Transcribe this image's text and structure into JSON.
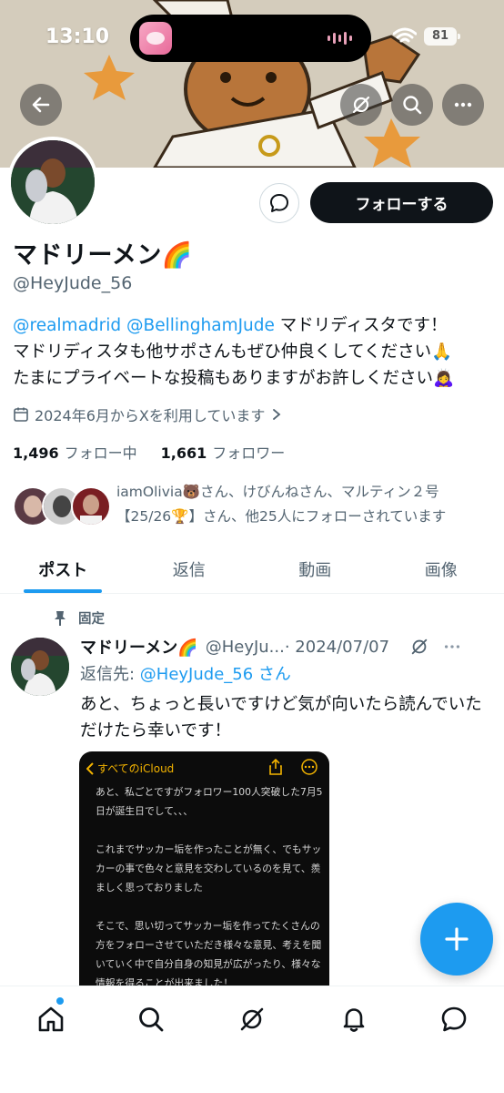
{
  "status_bar": {
    "time": "13:10",
    "battery": "81"
  },
  "header": {
    "back_icon": "arrow-left-icon",
    "grok_icon": "slash-circle-icon",
    "search_icon": "search-icon",
    "more_icon": "more-horizontal-icon"
  },
  "profile": {
    "name": "マドリーメン🌈",
    "handle": "@HeyJude_56",
    "follow_label": "フォローする",
    "bio_mention_1": "@realmadrid",
    "bio_mention_2": "@BellinghamJude",
    "bio_rest_1": " マドリディスタです！",
    "bio_line_2": "マドリディスタも他サポさんもぜひ仲良くしてください🙏",
    "bio_line_3": "たまにプライベートな投稿もありますがお許しください🙇‍♀️",
    "joined": "2024年6月からXを利用しています",
    "following_count": "1,496",
    "following_label": "フォロー中",
    "followers_count": "1,661",
    "followers_label": "フォロワー",
    "followed_by_1": "iamOlivia🐻さん、けびんねさん、マルティン２号",
    "followed_by_2": "【25/26🏆】さん、他25人にフォローされています"
  },
  "tabs": [
    {
      "label": "ポスト",
      "active": true
    },
    {
      "label": "返信",
      "active": false
    },
    {
      "label": "動画",
      "active": false
    },
    {
      "label": "画像",
      "active": false
    }
  ],
  "post": {
    "pinned_label": "固定",
    "author_name": "マドリーメン🌈",
    "author_handle": "@HeyJu...",
    "date": "· 2024/07/07",
    "reply_prefix": "返信先: ",
    "reply_target": "@HeyJude_56 さん",
    "text": "あと、ちょっと長いですけど気が向いたら読んでいただけたら幸いです！",
    "image": {
      "back_label": "すべてのiCloud",
      "body": "あと、私ごとですがフォロワー100人突破した7月5日が誕生日でして、、、\n\nこれまでサッカー垢を作ったことが無く、でもサッカーの事で色々と意見を交わしているのを見て、羨ましく思っておりました\n\nそこで、思い切ってサッカー垢を作ってたくさんの方をフォローさせていただき様々な意見、考えを聞いていく中で自分自身の知見が広がったり、様々な情報を得ることが出来ました！\nまた、他サポさんのツイートから様々なクラブ"
    }
  },
  "bottom_nav": [
    "home-icon",
    "search-icon",
    "grok-icon",
    "bell-icon",
    "messages-icon"
  ],
  "colors": {
    "accent": "#1d9bf0",
    "text": "#0f1419",
    "muted": "#536471"
  }
}
